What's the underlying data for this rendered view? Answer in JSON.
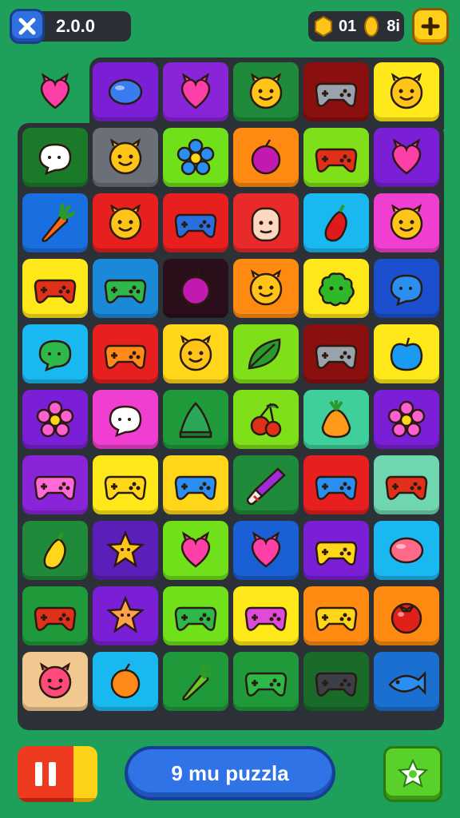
{
  "hud": {
    "version": "2.0.0",
    "coins_a": "01",
    "coins_b": "8i",
    "close_icon": "close-x-icon",
    "coin_icon": "gold-coin-icon",
    "plus_icon": "plus-icon"
  },
  "board": {
    "rows": [
      [
        {
          "bg": "",
          "icon": "heart",
          "c": "#ff3fa8"
        },
        {
          "bg": "#7b1fd6",
          "icon": "balloon",
          "c": "#3a7cf0"
        },
        {
          "bg": "#8a24d8",
          "icon": "heart",
          "c": "#ff3fa8"
        },
        {
          "bg": "#1f8a3a",
          "icon": "smiley",
          "c": "#ffc41a"
        },
        {
          "bg": "#8a0f0f",
          "icon": "gamepad",
          "c": "#9aa2ab"
        },
        {
          "bg": "#ffe91a",
          "icon": "smiley",
          "c": "#ffc41a"
        }
      ],
      [
        {
          "bg": "#1a7a2a",
          "icon": "bubble",
          "c": "#ffffff"
        },
        {
          "bg": "#6a6f78",
          "icon": "smiley",
          "c": "#ffc41a"
        },
        {
          "bg": "#6fe01a",
          "icon": "flower",
          "c": "#2a8ff0"
        },
        {
          "bg": "#ff8a12",
          "icon": "berry",
          "c": "#c21ab0"
        },
        {
          "bg": "#7fe01a",
          "icon": "gamepad",
          "c": "#e0301a"
        },
        {
          "bg": "#7a1fd6",
          "icon": "heart",
          "c": "#ff3fa8"
        }
      ],
      [
        {
          "bg": "#1a6fe0",
          "icon": "carrot",
          "c": "#ff6a1a"
        },
        {
          "bg": "#e81f1f",
          "icon": "smiley",
          "c": "#ffc41a"
        },
        {
          "bg": "#e81f1f",
          "icon": "gamepad",
          "c": "#2a6fe0"
        },
        {
          "bg": "#e82a2a",
          "icon": "face",
          "c": "#ffd6c0"
        },
        {
          "bg": "#1ab8f0",
          "icon": "pepper",
          "c": "#e01a1a"
        },
        {
          "bg": "#f03fd0",
          "icon": "smiley",
          "c": "#ffc41a"
        }
      ],
      [
        {
          "bg": "#ffe81a",
          "icon": "gamepad",
          "c": "#e0301a"
        },
        {
          "bg": "#1a8ad8",
          "icon": "gamepad",
          "c": "#2fb84a"
        },
        {
          "bg": "#2a0f1a",
          "icon": "berry",
          "c": "#c21ab0"
        },
        {
          "bg": "#ff8a12",
          "icon": "smiley",
          "c": "#ffc41a"
        },
        {
          "bg": "#ffe81a",
          "icon": "blob",
          "c": "#2fb82a"
        },
        {
          "bg": "#1a4fd0",
          "icon": "bubble",
          "c": "#2a8ff0"
        }
      ],
      [
        {
          "bg": "#1ab8f0",
          "icon": "bubble",
          "c": "#2fb84a"
        },
        {
          "bg": "#e81f1f",
          "icon": "gamepad",
          "c": "#ff8a1a"
        },
        {
          "bg": "#ffd61a",
          "icon": "smiley",
          "c": "#ffc41a"
        },
        {
          "bg": "#7fe01a",
          "icon": "leaf",
          "c": "#2a9a2a"
        },
        {
          "bg": "#8a0f0f",
          "icon": "gamepad",
          "c": "#9aa2ab"
        },
        {
          "bg": "#ffe81a",
          "icon": "apple",
          "c": "#1a9af0"
        }
      ],
      [
        {
          "bg": "#7a1fd6",
          "icon": "flower",
          "c": "#ff5fd0"
        },
        {
          "bg": "#f03fd0",
          "icon": "bubble",
          "c": "#ffffff"
        },
        {
          "bg": "#1f9a3a",
          "icon": "cone",
          "c": "#2aa85a"
        },
        {
          "bg": "#7fe01a",
          "icon": "cherry",
          "c": "#e0301a"
        },
        {
          "bg": "#3fcf9a",
          "icon": "pear",
          "c": "#ff9a1a"
        },
        {
          "bg": "#7a1fd6",
          "icon": "flower",
          "c": "#ff5fd0"
        }
      ],
      [
        {
          "bg": "#8a24d8",
          "icon": "gamepad",
          "c": "#ff6ad8"
        },
        {
          "bg": "#ffe81a",
          "icon": "gamepad",
          "c": "#ffd61a"
        },
        {
          "bg": "#ffd61a",
          "icon": "gamepad",
          "c": "#2a8ff0"
        },
        {
          "bg": "#1f8a3a",
          "icon": "brush",
          "c": "#a02ad8"
        },
        {
          "bg": "#e81f1f",
          "icon": "gamepad",
          "c": "#2a8ff0"
        },
        {
          "bg": "#6fd6b0",
          "icon": "gamepad",
          "c": "#e0301a"
        }
      ],
      [
        {
          "bg": "#1f8a3a",
          "icon": "pepper",
          "c": "#ffd61a"
        },
        {
          "bg": "#5a1fb8",
          "icon": "star",
          "c": "#ffc41a"
        },
        {
          "bg": "#6fe01a",
          "icon": "heart",
          "c": "#ff3fa8"
        },
        {
          "bg": "#1a5fd6",
          "icon": "heart",
          "c": "#ff3fa8"
        },
        {
          "bg": "#7a1fd6",
          "icon": "gamepad",
          "c": "#ffd61a"
        },
        {
          "bg": "#1ab8f0",
          "icon": "balloon",
          "c": "#ff6a8a"
        }
      ],
      [
        {
          "bg": "#1f9a3a",
          "icon": "gamepad",
          "c": "#e0301a"
        },
        {
          "bg": "#7a1fd6",
          "icon": "star",
          "c": "#ffa04a"
        },
        {
          "bg": "#6fe01a",
          "icon": "gamepad",
          "c": "#2fb84a"
        },
        {
          "bg": "#ffe81a",
          "icon": "gamepad",
          "c": "#e04ad8"
        },
        {
          "bg": "#ff8a12",
          "icon": "gamepad",
          "c": "#ffd61a"
        },
        {
          "bg": "#ff8a12",
          "icon": "tomato",
          "c": "#e0201a"
        }
      ],
      [
        {
          "bg": "#f0c890",
          "icon": "smiley",
          "c": "#ff4a7a"
        },
        {
          "bg": "#1ab8f0",
          "icon": "berry",
          "c": "#ff8a1a"
        },
        {
          "bg": "#1f9a3a",
          "icon": "carrot",
          "c": "#6ac82a"
        },
        {
          "bg": "#1f9a3a",
          "icon": "gamepad",
          "c": "#2fb84a"
        },
        {
          "bg": "#1a6a2a",
          "icon": "gamepad",
          "c": "#3a3f48"
        },
        {
          "bg": "#1a6fd0",
          "icon": "fish",
          "c": "#2a8ff0"
        }
      ]
    ]
  },
  "bottom": {
    "puzzle_label": "9 mu puzzla",
    "pause_icon": "pause-icon",
    "star_icon": "star-badge-icon"
  }
}
